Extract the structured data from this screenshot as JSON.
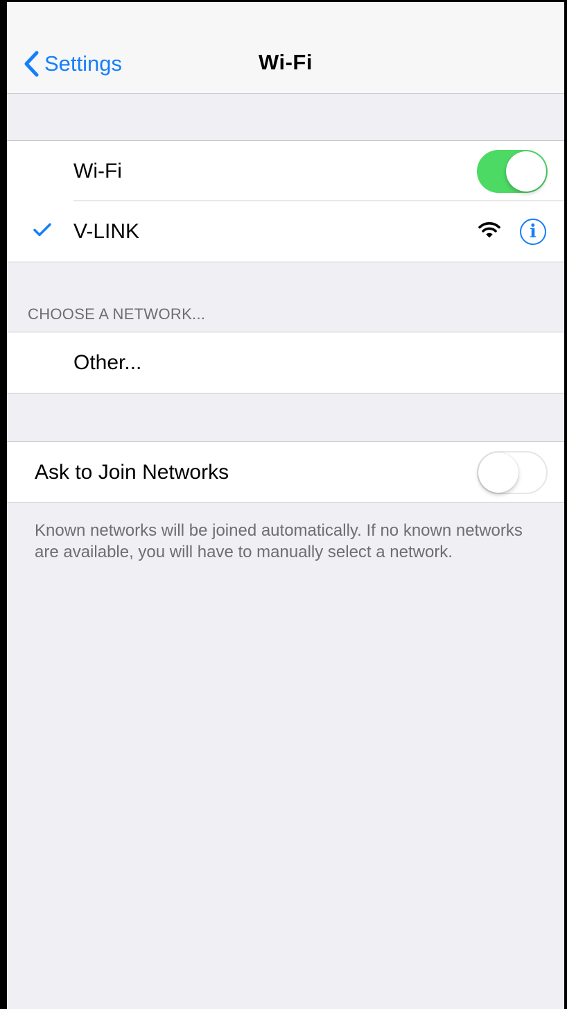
{
  "navbar": {
    "back_label": "Settings",
    "title": "Wi-Fi"
  },
  "wifi_group": {
    "toggle_label": "Wi-Fi",
    "toggle_on": true,
    "connected_network": "V-LINK",
    "info_glyph": "i"
  },
  "networks": {
    "header": "CHOOSE A NETWORK...",
    "other_label": "Other..."
  },
  "ask_join": {
    "label": "Ask to Join Networks",
    "toggle_on": false,
    "footer": "Known networks will be joined automatically. If no known networks are available, you will have to manually select a network."
  },
  "icons": {
    "back": "chevron-left-icon",
    "check": "checkmark-icon",
    "signal": "wifi-signal-icon",
    "info": "info-icon"
  },
  "colors": {
    "accent": "#157efb",
    "toggle_on": "#4cd964",
    "background": "#efeff4",
    "secondary_text": "#6d6d72"
  }
}
